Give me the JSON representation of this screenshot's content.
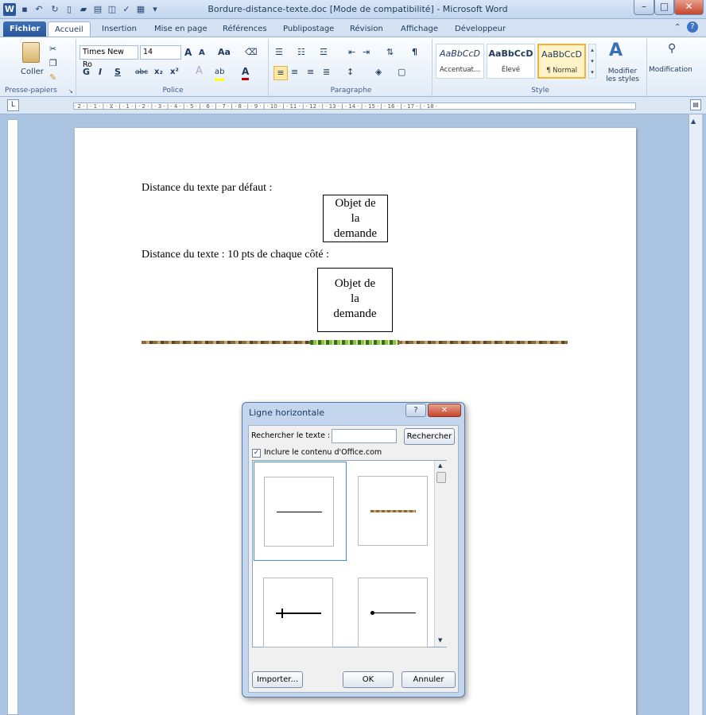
{
  "window": {
    "title": "Bordure-distance-texte.doc [Mode de compatibilité]  -  Microsoft Word",
    "app_icon": "W",
    "minimize": "–",
    "maximize": "□",
    "close": "✕",
    "help": "?",
    "collapse": "⌃"
  },
  "tabs": [
    {
      "label": "Fichier"
    },
    {
      "label": "Accueil"
    },
    {
      "label": "Insertion"
    },
    {
      "label": "Mise en page"
    },
    {
      "label": "Références"
    },
    {
      "label": "Publipostage"
    },
    {
      "label": "Révision"
    },
    {
      "label": "Affichage"
    },
    {
      "label": "Développeur"
    }
  ],
  "ribbon": {
    "clipboard": {
      "paste_label": "Coller",
      "group_label": "Presse-papiers"
    },
    "font": {
      "font_name": "Times New Ro",
      "font_size": "14",
      "bold": "G",
      "italic": "I",
      "underline": "S",
      "strike": "abc",
      "sub": "x₂",
      "sup": "x²",
      "grow": "A",
      "shrink": "A",
      "case": "Aa",
      "highlight": "ab",
      "color": "A",
      "group_label": "Police"
    },
    "paragraph": {
      "group_label": "Paragraphe",
      "pilcrow": "¶"
    },
    "styles": {
      "items": [
        {
          "preview": "AaBbCcD",
          "name": "Accentuat..."
        },
        {
          "preview": "AaBbCcD",
          "name": "Élevé"
        },
        {
          "preview": "AaBbCcD",
          "name": "¶ Normal"
        }
      ],
      "change_styles": "Modifier les styles",
      "group_label": "Style"
    },
    "editing": {
      "label": "Modification"
    }
  },
  "ruler": {
    "marks": "· 2 · | · 1 · | · ⧖ · | · 1 · | · 2 · | · 3 · | · 4 · | · 5 · | · 6 · | · 7 · | · 8 · | · 9 · | · 10 · | · 11 · | · 12 · | · 13 · | · 14 · | · 15 · | · 16 · | · 17 · | · 18 ·"
  },
  "document": {
    "line1": "Distance du texte par défaut :",
    "line2": "Distance du texte : 10 pts de chaque côté :",
    "box1": {
      "l1": "Objet de",
      "l2": "la",
      "l3": "demande"
    },
    "box2": {
      "l1": "Objet de",
      "l2": "la",
      "l3": "demande"
    }
  },
  "dialog": {
    "title": "Ligne horizontale",
    "search_label": "Rechercher le texte :",
    "search_value": "",
    "search_button": "Rechercher",
    "include_office_label": "Inclure le contenu d'Office.com",
    "include_office_checked": true,
    "check_mark": "✓",
    "import_button": "Importer...",
    "ok_button": "OK",
    "cancel_button": "Annuler",
    "help_button": "?",
    "close_button": "✕"
  }
}
